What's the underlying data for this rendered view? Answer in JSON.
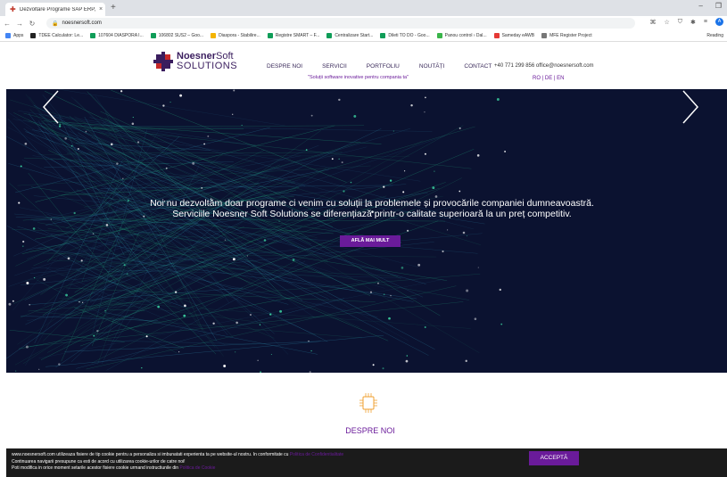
{
  "browser": {
    "tab_title": "Dezvoltare Programe SAP ERP, S",
    "tab_close": "×",
    "new_tab": "+",
    "url": "noesnersoft.com",
    "bookmarks": [
      {
        "label": "Apps",
        "icon": "apps-grid-icon",
        "color": "#4285f4"
      },
      {
        "label": "TDEE Calculator: Le...",
        "icon": "bookmark-icon",
        "color": "#222222"
      },
      {
        "label": "107604 DIASPORA I...",
        "icon": "drive-icon",
        "color": "#0f9d58"
      },
      {
        "label": "106802 SUS2 – Goo...",
        "icon": "drive-icon",
        "color": "#0f9d58"
      },
      {
        "label": "Diaspora - Stabilire...",
        "icon": "bookmark-icon",
        "color": "#f4b400"
      },
      {
        "label": "Registre SMART – F...",
        "icon": "sheets-icon",
        "color": "#0f9d58"
      },
      {
        "label": "Centralizare Start...",
        "icon": "sheets-icon",
        "color": "#0f9d58"
      },
      {
        "label": "Dileti TO DO - Goo...",
        "icon": "sheets-icon",
        "color": "#0f9d58"
      },
      {
        "label": "Panou control › Dal...",
        "icon": "bookmark-icon",
        "color": "#3ab54a"
      },
      {
        "label": "Sameday eAWB",
        "icon": "heart-icon",
        "color": "#e53935"
      },
      {
        "label": "MFE Register Project",
        "icon": "bookmark-icon",
        "color": "#777777"
      }
    ],
    "reading_list": "Reading"
  },
  "site": {
    "logo_word1": "Noesner",
    "logo_word2": "Soft",
    "logo_word3": "SOLUTIONS",
    "menu": [
      "DESPRE NOI",
      "SERVICII",
      "PORTFOLIU",
      "NOUTĂȚI",
      "CONTACT"
    ],
    "tagline": "\"Soluții software inovative pentru compania ta\"",
    "phone_email": "+40 771 299 856   office@noesnersoft.com",
    "languages": "RO | DE | EN",
    "hero_text": "Noi nu dezvoltăm doar programe ci venim cu soluții la problemele și provocările companiei dumneavoastră. Serviciile Noesner Soft Solutions se diferențiază printr-o calitate superioară la un preț competitiv.",
    "hero_button": "AFLĂ MAI MULT",
    "about_title": "DESPRE NOI",
    "cookie_line1": "www.noesnersoft.com utilizeaza fisiere de tip cookie pentru a personaliza si imbunatati experienta ta pe website-ul nostru. In conformitate cu",
    "cookie_link1": "Politica de Confidentialitate",
    "cookie_line2": "Continuarea navigarii presupune ca esti de acord cu utilizarea cookie-urilor de catre noi!",
    "cookie_line3": "Poti modifica in orice moment setarile acestor fisiere cookie urmand instructiunile din",
    "cookie_link2": "Politica de Cookie",
    "cookie_button": "ACCEPTĂ",
    "accent": "#6a1b9a"
  }
}
